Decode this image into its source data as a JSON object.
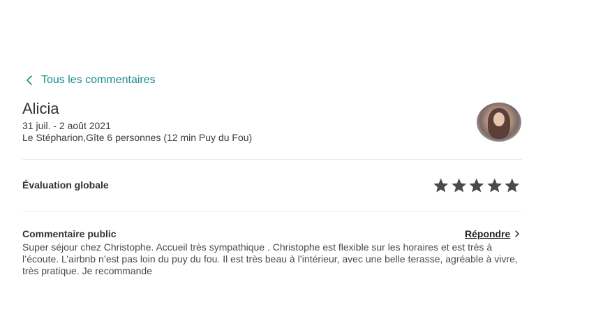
{
  "nav": {
    "back_label": "Tous les commentaires"
  },
  "guest": {
    "name": "Alicia",
    "dates": "31 juil. - 2 août 2021",
    "listing": "Le Stépharion,Gîte 6 personnes (12 min Puy du Fou)"
  },
  "rating": {
    "label": "Évaluation globale",
    "stars": 5,
    "max": 5
  },
  "comment": {
    "title": "Commentaire public",
    "reply_label": "Répondre",
    "text": "Super séjour chez Christophe. Accueil très sympathique . Christophe est flexible sur les horaires et est très à l’écoute. L’airbnb n’est pas loin du puy du fou. Il est très beau à l’intérieur, avec une belle terasse, agréable à vivre, très pratique. Je recommande"
  },
  "colors": {
    "accent": "#1a8e8c",
    "star": "#4a4a4a",
    "divider": "#ececec"
  },
  "icons": {
    "back": "chevron-left-icon",
    "reply": "chevron-right-icon",
    "star": "star-icon"
  }
}
